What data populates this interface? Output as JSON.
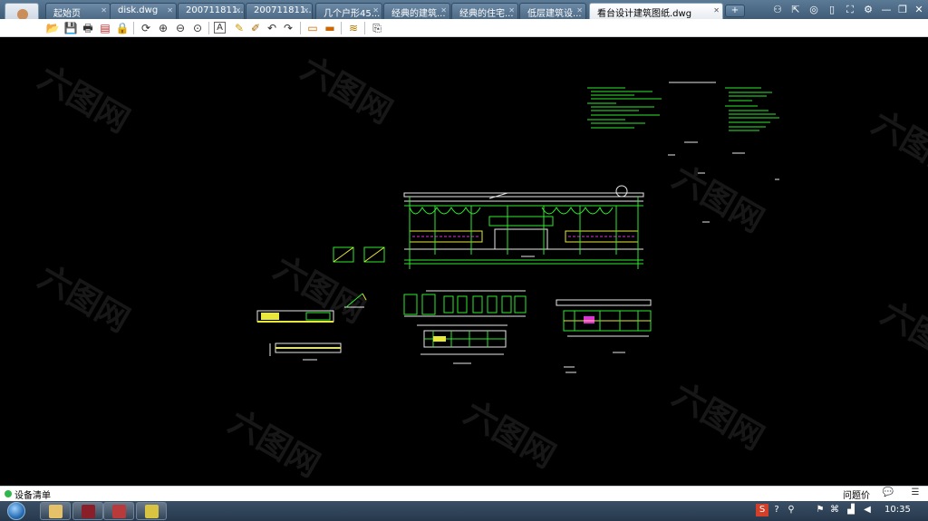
{
  "tabs": [
    {
      "label": "起始页",
      "active": false
    },
    {
      "label": "disk.dwg",
      "active": false
    },
    {
      "label": "200711811...",
      "active": false
    },
    {
      "label": "200711811...",
      "active": false
    },
    {
      "label": "几个户形45...",
      "active": false
    },
    {
      "label": "经典的建筑...",
      "active": false
    },
    {
      "label": "经典的住宅...",
      "active": false
    },
    {
      "label": "低层建筑设...",
      "active": false
    },
    {
      "label": "看台设计建筑图纸.dwg",
      "active": true
    }
  ],
  "new_tab_label": "+",
  "window_controls": [
    "users-icon",
    "share-icon",
    "skin-icon",
    "phone-icon",
    "fullscreen-icon",
    "settings-icon",
    "minimize-icon",
    "restore-icon",
    "close-icon"
  ],
  "toolbar_icons": [
    "open-icon",
    "save-icon",
    "print-icon",
    "pdf-icon",
    "lock-icon",
    "rotate-icon",
    "zoom-window-icon",
    "zoom-out-icon",
    "zoom-in-icon",
    "text-icon",
    "pencil-icon",
    "markup-icon",
    "undo-icon",
    "redo-icon",
    "measure-icon",
    "ruler-icon",
    "layers-icon",
    "export-icon"
  ],
  "watermark_text": "六图网",
  "status": {
    "label": "设备清单",
    "feedback": "问题价"
  },
  "taskbar": {
    "clock": "10:35"
  },
  "colors": {
    "canvas": "#000000",
    "tab_active": "#ffffff",
    "tabbar": "#4a6885",
    "cad_green": "#2ee82e",
    "cad_yellow": "#e8e83a",
    "cad_white": "#ffffff",
    "cad_magenta": "#e02ee0",
    "cad_cyan": "#2ee8e8"
  }
}
